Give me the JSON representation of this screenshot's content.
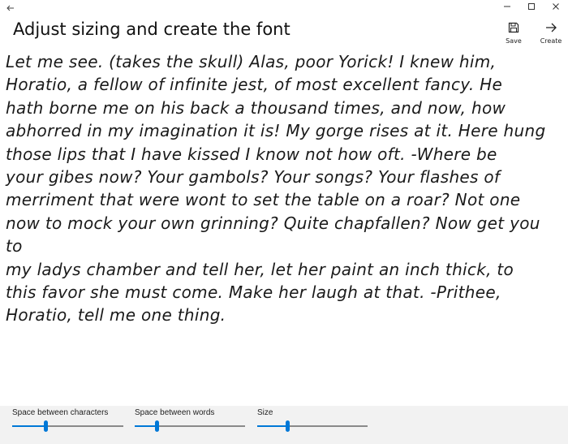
{
  "app": {
    "title": "Adjust sizing and create the font"
  },
  "window_controls": [
    "minimize-icon",
    "maximize-icon",
    "close-icon"
  ],
  "toolbar": {
    "save_label": "Save",
    "save_icon": "save-icon",
    "create_label": "Create",
    "create_icon": "arrow-right-icon"
  },
  "sample": {
    "lines": [
      "Let me see. (takes the skull) Alas, poor Yorick! I knew him,",
      "Horatio, a fellow of infinite jest, of most excellent fancy. He",
      "hath borne me on his back a thousand times, and now, how",
      "abhorred in my imagination it is! My gorge rises at it. Here hung",
      "those lips that I have kissed I know not how oft. -Where be",
      "your gibes now? Your gambols? Your songs? Your flashes of",
      "merriment that were wont to set the table on a roar? Not one",
      "now to mock your own grinning? Quite chapfallen? Now get you to",
      "my ladys chamber and tell her, let her paint an inch thick, to",
      "this favor she must come. Make her laugh at that. -Prithee,",
      "Horatio, tell me one thing."
    ]
  },
  "sliders": [
    {
      "label": "Space between characters",
      "value": 0.3
    },
    {
      "label": "Space between words",
      "value": 0.2
    },
    {
      "label": "Size",
      "value": 0.27
    }
  ],
  "colors": {
    "accent": "#0078d7",
    "panel": "#f2f2f2"
  }
}
